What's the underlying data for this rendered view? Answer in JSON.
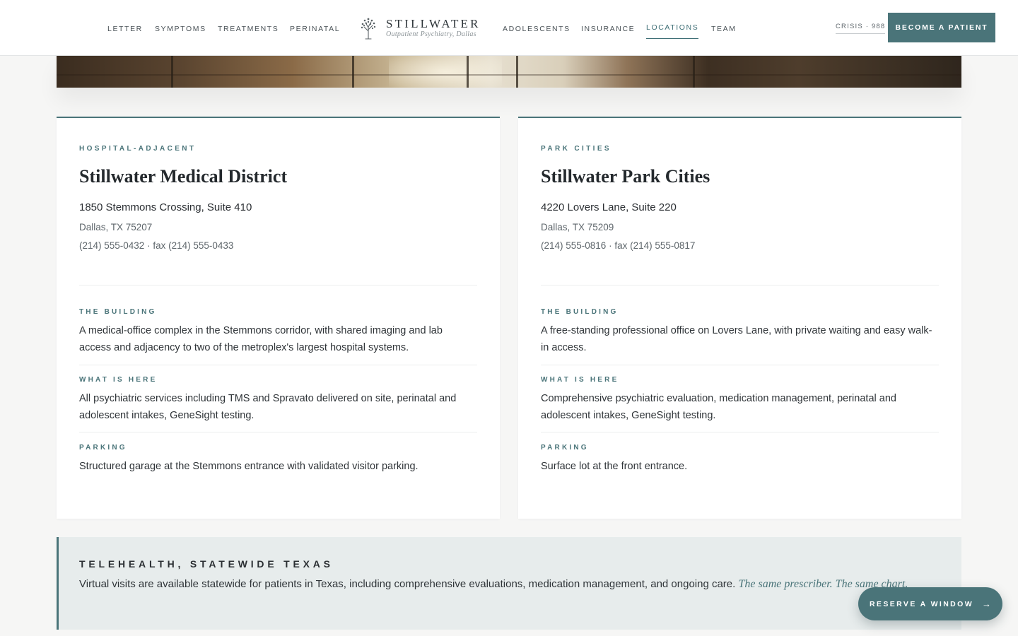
{
  "brand": {
    "name": "STILLWATER",
    "tagline": "Outpatient Psychiatry, Dallas",
    "icon": "tree-icon"
  },
  "nav": {
    "left": [
      "LETTER",
      "SYMPTOMS",
      "TREATMENTS",
      "PERINATAL"
    ],
    "right": [
      "ADOLESCENTS",
      "INSURANCE",
      "LOCATIONS",
      "TEAM"
    ],
    "active": "LOCATIONS"
  },
  "header": {
    "crisis": "CRISIS · 988",
    "cta": "BECOME A PATIENT"
  },
  "locations": [
    {
      "eyebrow": "HOSPITAL-ADJACENT",
      "title": "Stillwater Medical District",
      "address_line1": "1850 Stemmons Crossing, Suite 410",
      "address_line2": "Dallas, TX 75207",
      "phone": "(214) 555-0432 · fax (214) 555-0433",
      "sections": [
        {
          "label": "THE BUILDING",
          "body": "A medical-office complex in the Stemmons corridor, with shared imaging and lab access and adjacency to two of the metroplex's largest hospital systems."
        },
        {
          "label": "WHAT IS HERE",
          "body": "All psychiatric services including TMS and Spravato delivered on site, perinatal and adolescent intakes, GeneSight testing."
        },
        {
          "label": "PARKING",
          "body": "Structured garage at the Stemmons entrance with validated visitor parking."
        }
      ]
    },
    {
      "eyebrow": "PARK CITIES",
      "title": "Stillwater Park Cities",
      "address_line1": "4220 Lovers Lane, Suite 220",
      "address_line2": "Dallas, TX 75209",
      "phone": "(214) 555-0816 · fax (214) 555-0817",
      "sections": [
        {
          "label": "THE BUILDING",
          "body": "A free-standing professional office on Lovers Lane, with private waiting and easy walk-in access."
        },
        {
          "label": "WHAT IS HERE",
          "body": "Comprehensive psychiatric evaluation, medication management, perinatal and adolescent intakes, GeneSight testing."
        },
        {
          "label": "PARKING",
          "body": "Surface lot at the front entrance."
        }
      ]
    }
  ],
  "telehealth": {
    "title": "TELEHEALTH, STATEWIDE TEXAS",
    "body": "Virtual visits are available statewide for patients in Texas, including comprehensive evaluations, medication management, and ongoing care.",
    "emphasis": "The same prescriber. The same chart."
  },
  "floating": {
    "label": "RESERVE A WINDOW",
    "arrow": "→"
  },
  "colors": {
    "accent": "#4a7479",
    "banner_bg": "#e7ecec",
    "page_bg": "#f6f6f5"
  }
}
